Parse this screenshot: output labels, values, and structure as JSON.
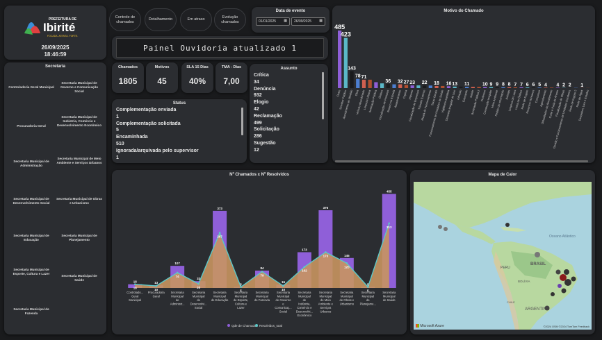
{
  "header": {
    "org_top": "PREFEITURA DE",
    "org_name": "Ibirité",
    "org_slogan": "FOCADA. ATENTA. FORTE.",
    "date": "26/09/2025",
    "time": "18:46:59"
  },
  "buttons": [
    "Controle de chamados",
    "Detalhamento",
    "Em atraso",
    "Evolução chamados"
  ],
  "date_filter": {
    "label": "Data de evento",
    "from": "01/01/2025",
    "to": "26/09/2025"
  },
  "banner": "Painel Ouvidoria atualizado 1",
  "kpis": [
    {
      "label": "Chamados",
      "value": "1805"
    },
    {
      "label": "Motivos",
      "value": "45"
    },
    {
      "label": "SLA 15 Dias",
      "value": "40%"
    },
    {
      "label": "TMA - Dias",
      "value": "7,00"
    }
  ],
  "secretarias": {
    "title": "Secretaria",
    "items": [
      "Controladoria Geral Municipal",
      "Secretaria Municipal de Governo e Comunicação Social",
      "Procuradoria Geral",
      "Secretaria Municipal de Indústria, Comércio e Desenvolvimento Econômico",
      "Secretaria Municipal de Administração",
      "Secretaria Municipal de Meio Ambiente e Serviços Urbanos",
      "Secretaria Municipal de Desenvolvimento Social",
      "Secretaria Municipal de Obras e Urbanismo",
      "Secretaria Municipal de Educação",
      "Secretaria Municipal de Planejamento",
      "Secretaria Municipal de Esporte, Cultura e Lazer",
      "Secretaria Municipal de Saúde",
      "Secretaria Municipal de Fazenda"
    ]
  },
  "status": {
    "title": "Status",
    "items": [
      "Complementação enviada",
      "1",
      "Complementação solicitada",
      "5",
      "Encaminhada",
      "510",
      "Ignorada/arquivada pelo supervisor",
      "1"
    ]
  },
  "assunto": {
    "title": "Assunto",
    "items": [
      "Crítica",
      "34",
      "Denúncia",
      "932",
      "Elogio",
      "42",
      "Reclamação",
      "499",
      "Solicitação",
      "286",
      "Sugestão",
      "12"
    ]
  },
  "motivo_chart": {
    "title": "Motivo do Chamado",
    "type": "bar",
    "categories": [
      "Outro",
      "Servidor Público",
      "Atendimento ao cidadão",
      "Obra",
      "Veículo abandonado",
      "Limpeza Urbana",
      "Iluminação Pública",
      "Ônibus",
      "Fiscalização de Posturas",
      "Buraco na Estrada",
      "Abastecimento",
      "Capina",
      "Imposto",
      "Fiscalização de Empresas",
      "Trânsito Externo",
      "Alvará de Funcionamento",
      "Taxas Gerais",
      "Funcionamento de Unidades de Saúde",
      "Vigilância Sanitária",
      "Descarte Irregular de Lixo",
      "Infração",
      "Educação",
      "Saúde",
      "Iluminação Pública 2",
      "Professor",
      "Construção Irregular",
      "Meio Ambiente",
      "Pedido de Informação",
      "Animais",
      "Limpeza de Lotes",
      "Linha de Ônibus",
      "Rede de Esgoto",
      "Recursos Humanos",
      "Concursos",
      "Agendamento",
      "Dificuldades de Atendimento",
      "Corte e Poda de Árvore",
      "Fiscalização de Obras",
      "Gestão e Funcionamento de Unidades Escolares",
      "Rede de Esgoto 2",
      "Rede de Água",
      "Desordem, Lixo e Entulho"
    ],
    "values": [
      485,
      423,
      143,
      78,
      71,
      71,
      50,
      40,
      36,
      32,
      32,
      27,
      23,
      23,
      22,
      22,
      18,
      18,
      16,
      13,
      13,
      11,
      11,
      11,
      10,
      9,
      9,
      8,
      8,
      7,
      7,
      6,
      6,
      5,
      4,
      4,
      4,
      2,
      2,
      2,
      1,
      1
    ],
    "labels": [
      "485",
      "423",
      "143",
      "78",
      "71",
      "",
      "",
      "",
      "36",
      "",
      "32",
      "27",
      "23",
      "",
      "22",
      "",
      "18",
      "",
      "16",
      "13",
      "",
      "11",
      "",
      "",
      "10",
      "9",
      "9",
      "8",
      "8",
      "7",
      "7",
      "6",
      "6",
      "5",
      "4",
      "",
      "4",
      "2",
      "2",
      "",
      "1",
      ""
    ],
    "colors": [
      "#8f5fd8",
      "#5bb8c8",
      "#1a1b1d",
      "#4d7fd1",
      "#d06050",
      "#b05030"
    ]
  },
  "chart_data": {
    "type": "bar",
    "title": "Nº Chamados x Nº Resolvidos",
    "categories": [
      "Controlado... Geral Municipal",
      "Procuradoria Geral",
      "Secretaria Municipal de Administr...",
      "Secretaria Municipal de Desenvolvi... Social",
      "Secretaria Municipal de Educação",
      "Secretaria Municipal de Esporte, Cultura e Lazer",
      "Secretaria Municipal de Fazenda",
      "Secretaria Municipal de Governo e Comunicaç... Social",
      "Secretaria Municipal de Indústria, Comércio e Desenvolvi... Econômico",
      "Secretaria Municipal de Meio Ambiente e Serviços Urbanos",
      "Secretaria Municipal de Obras e Urbanismo",
      "Secretaria Municipal de Planejame...",
      "Secretaria Municipal de Saúde"
    ],
    "series": [
      {
        "name": "Qde de Chamados",
        "values": [
          18,
          13,
          107,
          33,
          373,
          5,
          84,
          16,
          173,
          376,
          145,
          5,
          455
        ]
      },
      {
        "name": "Resolvidos_total",
        "values": [
          18,
          10,
          74,
          20,
          267,
          5,
          79,
          10,
          102,
          173,
          120,
          5,
          313
        ]
      }
    ],
    "value_labels": {
      "chamados": [
        "18",
        "13",
        "107",
        "33",
        "373",
        "5",
        "84",
        "16",
        "173",
        "376",
        "145",
        "5",
        "455"
      ],
      "resolvidos": [
        "18",
        "10",
        "74",
        "20",
        "267",
        "5",
        "79",
        "10",
        "102",
        "173",
        "120",
        "5",
        "313"
      ]
    },
    "ylim": [
      0,
      470
    ],
    "colors": {
      "chamados": "#8f5fd8",
      "resolvidos": "#c89560",
      "line": "#5bc8c8"
    }
  },
  "map": {
    "title": "Mapa de Calor",
    "labels": [
      "Oceano Atlântico",
      "PERU",
      "BRASIL",
      "BOLÍVIA",
      "ARGENTINA",
      "CHILE"
    ],
    "attribution": "Microsoft Azure",
    "copyright": "©2024 OSM ©2024 TomTom Feedback"
  }
}
